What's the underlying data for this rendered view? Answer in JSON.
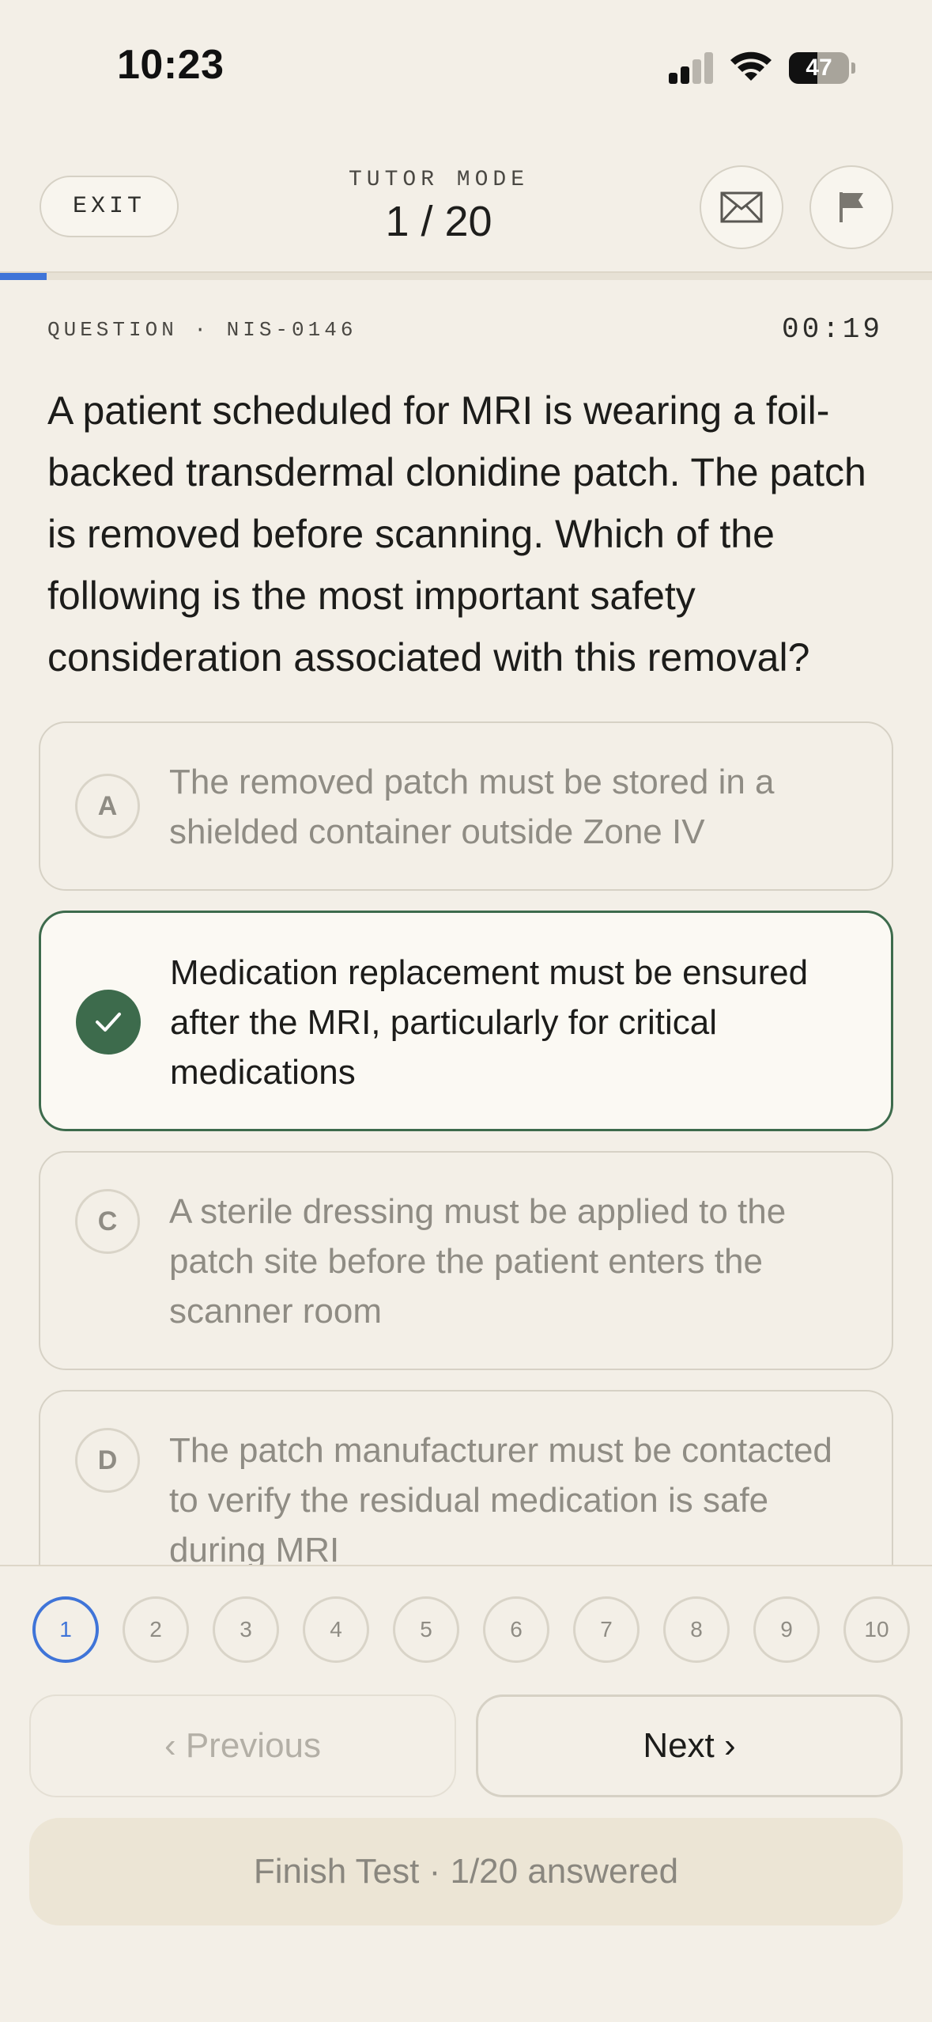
{
  "status_bar": {
    "time": "10:23",
    "battery": "47",
    "battery_level": 0.47,
    "icons": [
      "cellular-signal-icon",
      "wifi-icon",
      "battery-icon"
    ]
  },
  "header": {
    "exit_label": "EXIT",
    "mode_label": "TUTOR MODE",
    "progress": "1 / 20",
    "progress_fraction": 0.05,
    "icons": [
      "envelope-icon",
      "flag-icon"
    ]
  },
  "question": {
    "meta": "QUESTION · NIS-0146",
    "timer": "00:19",
    "text": "A patient scheduled for MRI is wearing a foil-backed transdermal clonidine patch. The patch is removed before scanning. Which of the following is the most important safety consideration associated with this removal?"
  },
  "options": [
    {
      "letter": "A",
      "text": "The removed patch must be stored in a shielded container outside Zone IV",
      "selected": false
    },
    {
      "letter": "B",
      "text": "Medication replacement must be ensured after the MRI, particularly for critical medications",
      "selected": true
    },
    {
      "letter": "C",
      "text": "A sterile dressing must be applied to the patch site before the patient enters the scanner room",
      "selected": false
    },
    {
      "letter": "D",
      "text": "The patch manufacturer must be contacted to verify the residual medication is safe during MRI",
      "selected": false
    }
  ],
  "question_nav": [
    "1",
    "2",
    "3",
    "4",
    "5",
    "6",
    "7",
    "8",
    "9",
    "10"
  ],
  "current_question": "1",
  "buttons": {
    "previous": "‹ Previous",
    "next": "Next ›",
    "finish": "Finish Test · 1/20 answered"
  },
  "colors": {
    "accent_blue": "#3f74d8",
    "selected_green": "#3d6b4c",
    "background": "#f3efe7"
  }
}
